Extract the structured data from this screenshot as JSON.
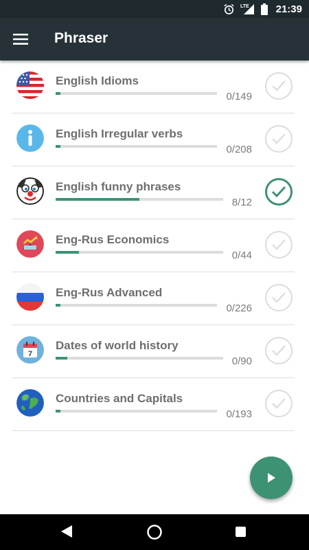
{
  "status_bar": {
    "time": "21:39",
    "network": "LTE",
    "icons": [
      "alarm-icon",
      "signal-icon",
      "battery-icon"
    ]
  },
  "app_bar": {
    "title": "Phraser",
    "menu_icon": "hamburger-menu-icon"
  },
  "theme": {
    "accent": "#3d9274",
    "app_bar": "#263238",
    "status_bar": "#1f2a2f",
    "track": "#dcdcdc"
  },
  "list": {
    "items": [
      {
        "title": "English Idioms",
        "count": "0/149",
        "progress": 0.03,
        "icon": "us-flag-icon",
        "completed": false
      },
      {
        "title": "English Irregular verbs",
        "count": "0/208",
        "progress": 0.03,
        "icon": "info-icon",
        "completed": false
      },
      {
        "title": "English funny phrases",
        "count": "8/12",
        "progress": 0.5,
        "icon": "clown-face-icon",
        "completed": true
      },
      {
        "title": "Eng-Rus Economics",
        "count": "0/44",
        "progress": 0.14,
        "icon": "economics-chart-icon",
        "completed": false
      },
      {
        "title": "Eng-Rus Advanced",
        "count": "0/226",
        "progress": 0.03,
        "icon": "russian-flag-icon",
        "completed": false
      },
      {
        "title": "Dates of world history",
        "count": "0/90",
        "progress": 0.07,
        "icon": "calendar-icon",
        "completed": false
      },
      {
        "title": "Countries and Capitals",
        "count": "0/193",
        "progress": 0.03,
        "icon": "globe-icon",
        "completed": false
      }
    ]
  },
  "fab": {
    "icon": "play-icon"
  },
  "nav_bar": {
    "icons": [
      "back-icon",
      "home-icon",
      "recents-icon"
    ]
  }
}
